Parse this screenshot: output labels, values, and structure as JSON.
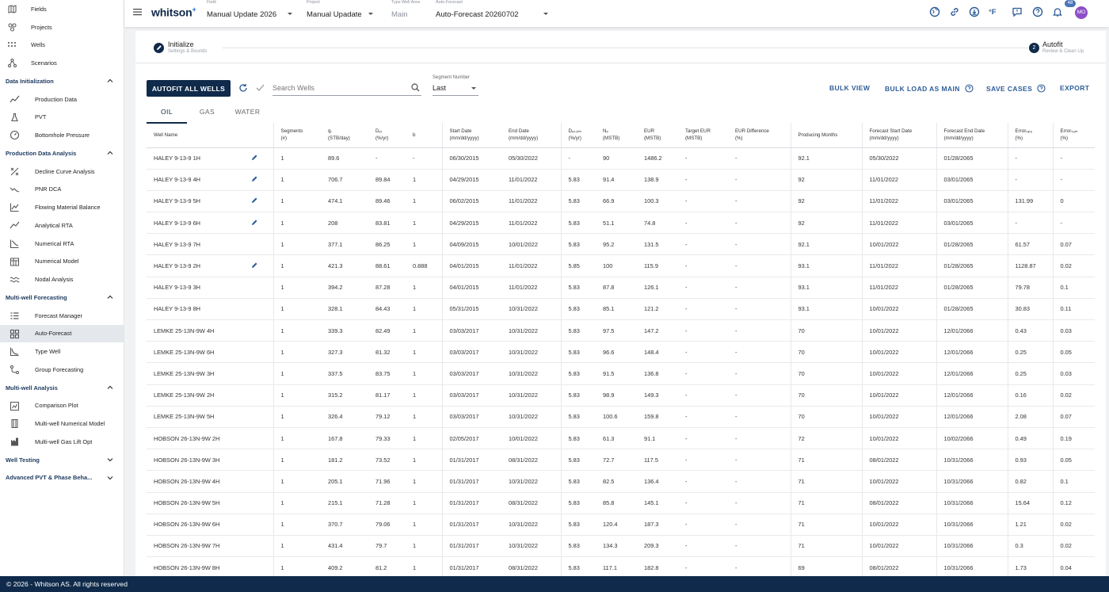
{
  "sidebar": {
    "top_items": [
      {
        "label": "Fields",
        "icon": "map-icon"
      },
      {
        "label": "Projects",
        "icon": "projects-icon"
      },
      {
        "label": "Wells",
        "icon": "wells-icon"
      },
      {
        "label": "Scenarios",
        "icon": "scenarios-icon"
      }
    ],
    "sections": [
      {
        "title": "Data Initialization",
        "expanded": true,
        "items": [
          {
            "label": "Production Data",
            "icon": "production-data-icon"
          },
          {
            "label": "PVT",
            "icon": "flask-icon"
          },
          {
            "label": "Bottomhole Pressure",
            "icon": "gauge-icon"
          }
        ]
      },
      {
        "title": "Production Data Analysis",
        "expanded": true,
        "items": [
          {
            "label": "Decline Curve Analysis",
            "icon": "decline-curve-icon"
          },
          {
            "label": "PNR DCA",
            "icon": "pnr-dca-icon"
          },
          {
            "label": "Flowing Material Balance",
            "icon": "material-balance-icon"
          },
          {
            "label": "Analytical RTA",
            "icon": "analytical-rta-icon"
          },
          {
            "label": "Numerical RTA",
            "icon": "numerical-rta-icon"
          },
          {
            "label": "Numerical Model",
            "icon": "numerical-model-icon"
          },
          {
            "label": "Nodal Analysis",
            "icon": "nodal-analysis-icon"
          }
        ]
      },
      {
        "title": "Multi-well Forecasting",
        "expanded": true,
        "items": [
          {
            "label": "Forecast Manager",
            "icon": "forecast-manager-icon"
          },
          {
            "label": "Auto-Forecast",
            "icon": "auto-forecast-icon",
            "active": true
          },
          {
            "label": "Type Well",
            "icon": "type-well-icon"
          },
          {
            "label": "Group Forecasting",
            "icon": "group-forecasting-icon"
          }
        ]
      },
      {
        "title": "Multi-well Analysis",
        "expanded": true,
        "items": [
          {
            "label": "Comparison Plot",
            "icon": "comparison-plot-icon"
          },
          {
            "label": "Multi-well Numerical Model",
            "icon": "multiwell-model-icon"
          },
          {
            "label": "Multi-well Gas Lift Opt",
            "icon": "gas-lift-icon"
          }
        ]
      },
      {
        "title": "Well Testing",
        "expanded": false,
        "items": []
      },
      {
        "title": "Advanced PVT & Phase Beha...",
        "expanded": false,
        "items": []
      }
    ]
  },
  "topbar": {
    "logo": "whitson",
    "logo_mark": "+",
    "selectors": [
      {
        "label": "Field",
        "value": "Manual Update 2026",
        "disabled": false
      },
      {
        "label": "Project",
        "value": "Manual Upadate",
        "disabled": false
      },
      {
        "label": "Type Well Area",
        "value": "Main",
        "disabled": true
      },
      {
        "label": "Auto-Forecast",
        "value": "Auto-Forecast 20260702",
        "disabled": false
      }
    ],
    "unit_label": "°F",
    "notification_count": "48",
    "avatar_initials": "MO"
  },
  "stepper": {
    "step1_title": "Initialize",
    "step1_subtitle": "Settings & Bounds",
    "step2_number": "2",
    "step2_title": "Autofit",
    "step2_subtitle": "Review & Clean Up"
  },
  "toolbar": {
    "autofit_label": "AUTOFIT ALL WELLS",
    "search_placeholder": "Search Wells",
    "segment_label": "Segment Number",
    "segment_value": "Last",
    "bulk_view": "BULK VIEW",
    "bulk_load": "BULK LOAD AS MAIN",
    "save_cases": "SAVE CASES",
    "export": "EXPORT"
  },
  "tabs": [
    {
      "label": "OIL",
      "active": true
    },
    {
      "label": "GAS",
      "active": false
    },
    {
      "label": "WATER",
      "active": false
    }
  ],
  "table": {
    "columns": [
      {
        "l1": "Well Name",
        "l2": ""
      },
      {
        "l1": "",
        "l2": ""
      },
      {
        "l1": "Segments",
        "l2": "(#)"
      },
      {
        "l1": "qᵢ",
        "l2": "(STB/day)"
      },
      {
        "l1": "Dₑᵢ",
        "l2": "(%/yr)"
      },
      {
        "l1": "b",
        "l2": ""
      },
      {
        "l1": "Start Date",
        "l2": "(mm/dd/yyyy)"
      },
      {
        "l1": "End Date",
        "l2": "(mm/dd/yyyy)"
      },
      {
        "l1": "Dₑₛ,ₗᵢₘ",
        "l2": "(%/yr)"
      },
      {
        "l1": "Nₚ",
        "l2": "(MSTB)"
      },
      {
        "l1": "EUR",
        "l2": "(MSTB)"
      },
      {
        "l1": "Target EUR",
        "l2": "(MSTB)"
      },
      {
        "l1": "EUR Difference",
        "l2": "(%)"
      },
      {
        "l1": "Producing Months",
        "l2": ""
      },
      {
        "l1": "Forecast Start Date",
        "l2": "(mm/dd/yyyy)"
      },
      {
        "l1": "Forecast End Date",
        "l2": "(mm/dd/yyyy)"
      },
      {
        "l1": "Errorᵣₐₜₑ",
        "l2": "(%)"
      },
      {
        "l1": "Errorₛᵤₘ",
        "l2": "(%)"
      }
    ],
    "rows": [
      {
        "name": "HALEY 9-13-9 1H",
        "edit": true,
        "cells": [
          "1",
          "89.6",
          "-",
          "-",
          "06/30/2015",
          "05/30/2022",
          "-",
          "90",
          "1486.2",
          "-",
          "-",
          "92.1",
          "05/30/2022",
          "01/28/2065",
          "-",
          "-"
        ]
      },
      {
        "name": "HALEY 9-13-9 4H",
        "edit": true,
        "cells": [
          "1",
          "706.7",
          "89.84",
          "1",
          "04/29/2015",
          "11/01/2022",
          "5.83",
          "91.4",
          "138.9",
          "-",
          "-",
          "92",
          "11/01/2022",
          "03/01/2065",
          "-",
          "-"
        ]
      },
      {
        "name": "HALEY 9-13-9 5H",
        "edit": true,
        "cells": [
          "1",
          "474.1",
          "89.46",
          "1",
          "06/02/2015",
          "11/01/2022",
          "5.83",
          "66.9",
          "100.3",
          "-",
          "-",
          "92",
          "11/01/2022",
          "03/01/2065",
          "131.99",
          "0"
        ]
      },
      {
        "name": "HALEY 9-13-9 6H",
        "edit": true,
        "cells": [
          "1",
          "208",
          "83.81",
          "1",
          "04/29/2015",
          "11/01/2022",
          "5.83",
          "51.1",
          "74.8",
          "-",
          "-",
          "92",
          "11/01/2022",
          "03/01/2065",
          "-",
          "-"
        ]
      },
      {
        "name": "HALEY 9-13-9 7H",
        "edit": false,
        "cells": [
          "1",
          "377.1",
          "86.25",
          "1",
          "04/09/2015",
          "10/01/2022",
          "5.83",
          "95.2",
          "131.5",
          "-",
          "-",
          "92.1",
          "10/01/2022",
          "01/28/2065",
          "61.57",
          "0.07"
        ]
      },
      {
        "name": "HALEY 9-13-9 2H",
        "edit": true,
        "cells": [
          "1",
          "421.3",
          "88.61",
          "0.888",
          "04/01/2015",
          "11/01/2022",
          "5.85",
          "100",
          "115.9",
          "-",
          "-",
          "93.1",
          "11/01/2022",
          "01/28/2065",
          "1128.87",
          "0.02"
        ]
      },
      {
        "name": "HALEY 9-13-9 3H",
        "edit": false,
        "cells": [
          "1",
          "394.2",
          "87.28",
          "1",
          "04/01/2015",
          "11/01/2022",
          "5.83",
          "87.8",
          "126.1",
          "-",
          "-",
          "93.1",
          "11/01/2022",
          "01/28/2065",
          "79.78",
          "0.1"
        ]
      },
      {
        "name": "HALEY 9-13-9 8H",
        "edit": false,
        "cells": [
          "1",
          "328.1",
          "84.43",
          "1",
          "05/31/2015",
          "10/31/2022",
          "5.83",
          "85.1",
          "121.2",
          "-",
          "-",
          "93.1",
          "10/01/2022",
          "01/28/2065",
          "30.83",
          "0.11"
        ]
      },
      {
        "name": "LEMKE 25-13N-9W 4H",
        "edit": false,
        "cells": [
          "1",
          "339.3",
          "82.49",
          "1",
          "03/03/2017",
          "10/31/2022",
          "5.83",
          "97.5",
          "147.2",
          "-",
          "-",
          "70",
          "10/01/2022",
          "12/01/2066",
          "0.43",
          "0.03"
        ]
      },
      {
        "name": "LEMKE 25-13N-9W 6H",
        "edit": false,
        "cells": [
          "1",
          "327.3",
          "81.32",
          "1",
          "03/03/2017",
          "10/31/2022",
          "5.83",
          "96.6",
          "148.4",
          "-",
          "-",
          "70",
          "10/01/2022",
          "12/01/2066",
          "0.25",
          "0.05"
        ]
      },
      {
        "name": "LEMKE 25-13N-9W 3H",
        "edit": false,
        "cells": [
          "1",
          "337.5",
          "83.75",
          "1",
          "03/03/2017",
          "10/31/2022",
          "5.83",
          "91.5",
          "136.8",
          "-",
          "-",
          "70",
          "10/01/2022",
          "12/01/2066",
          "0.25",
          "0.03"
        ]
      },
      {
        "name": "LEMKE 25-13N-9W 2H",
        "edit": false,
        "cells": [
          "1",
          "315.2",
          "81.17",
          "1",
          "03/03/2017",
          "10/31/2022",
          "5.83",
          "98.9",
          "149.3",
          "-",
          "-",
          "70",
          "10/01/2022",
          "12/01/2066",
          "0.16",
          "0.02"
        ]
      },
      {
        "name": "LEMKE 25-13N-9W 5H",
        "edit": false,
        "cells": [
          "1",
          "326.4",
          "79.12",
          "1",
          "03/03/2017",
          "10/31/2022",
          "5.83",
          "100.6",
          "159.8",
          "-",
          "-",
          "70",
          "10/01/2022",
          "12/01/2066",
          "2.08",
          "0.07"
        ]
      },
      {
        "name": "HOBSON 26-13N-9W 2H",
        "edit": false,
        "cells": [
          "1",
          "167.8",
          "79.33",
          "1",
          "02/05/2017",
          "10/01/2022",
          "5.83",
          "61.3",
          "91.1",
          "-",
          "-",
          "72",
          "10/01/2022",
          "10/02/2066",
          "0.49",
          "0.19"
        ]
      },
      {
        "name": "HOBSON 26-13N-9W 3H",
        "edit": false,
        "cells": [
          "1",
          "181.2",
          "73.52",
          "1",
          "01/31/2017",
          "08/31/2022",
          "5.83",
          "72.7",
          "117.5",
          "-",
          "-",
          "71",
          "08/01/2022",
          "10/31/2066",
          "0.93",
          "0.05"
        ]
      },
      {
        "name": "HOBSON 26-13N-9W 4H",
        "edit": false,
        "cells": [
          "1",
          "205.1",
          "71.96",
          "1",
          "01/31/2017",
          "10/31/2022",
          "5.83",
          "82.5",
          "136.4",
          "-",
          "-",
          "71",
          "10/01/2022",
          "10/31/2066",
          "0.82",
          "0.1"
        ]
      },
      {
        "name": "HOBSON 26-13N-9W 5H",
        "edit": false,
        "cells": [
          "1",
          "215.1",
          "71.28",
          "1",
          "01/31/2017",
          "08/31/2022",
          "5.83",
          "85.8",
          "145.1",
          "-",
          "-",
          "71",
          "08/01/2022",
          "10/31/2066",
          "15.64",
          "0.12"
        ]
      },
      {
        "name": "HOBSON 26-13N-9W 6H",
        "edit": false,
        "cells": [
          "1",
          "370.7",
          "79.06",
          "1",
          "01/31/2017",
          "10/31/2022",
          "5.83",
          "120.4",
          "187.3",
          "-",
          "-",
          "71",
          "10/01/2022",
          "10/31/2066",
          "1.21",
          "0.02"
        ]
      },
      {
        "name": "HOBSON 26-13N-9W 7H",
        "edit": false,
        "cells": [
          "1",
          "431.4",
          "79.7",
          "1",
          "01/31/2017",
          "10/31/2022",
          "5.83",
          "134.3",
          "209.3",
          "-",
          "-",
          "71",
          "10/01/2022",
          "10/31/2066",
          "0.3",
          "0.02"
        ]
      },
      {
        "name": "HOBSON 26-13N-9W 8H",
        "edit": false,
        "cells": [
          "1",
          "409.2",
          "81.2",
          "1",
          "01/31/2017",
          "08/31/2022",
          "5.83",
          "117.1",
          "182.8",
          "-",
          "-",
          "69",
          "08/01/2022",
          "10/31/2066",
          "1.73",
          "0.04"
        ]
      }
    ]
  },
  "footer": {
    "text": "© 2026 - Whitson AS. All rights reserved"
  },
  "colors": {
    "navy": "#0f2a4a",
    "link": "#2d5c96",
    "active_bg": "#e4e7ec",
    "avatar": "#8e4fc6"
  }
}
